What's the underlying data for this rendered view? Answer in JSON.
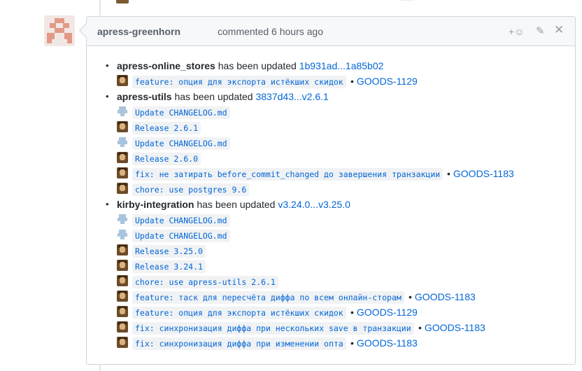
{
  "comment": {
    "author": "apress-greenhorn",
    "action": "commented",
    "time": "6 hours ago"
  },
  "header_icons": [
    "add-reaction-icon",
    "pencil-icon",
    "close-icon"
  ],
  "colors": {
    "link": "#0366d6",
    "header_bg": "#f6f8fa",
    "border": "#d1d5da",
    "avatar_accent": "#e39986"
  },
  "repos": [
    {
      "name": "apress-online_stores",
      "verb": "has been updated",
      "range": "1b931ad...1a85b02",
      "commits": [
        {
          "icon": "user",
          "message": "feature: опция для экспорта истёкших скидок",
          "ticket": "GOODS-1129"
        }
      ]
    },
    {
      "name": "apress-utils",
      "verb": "has been updated",
      "range": "3837d43...v2.6.1",
      "commits": [
        {
          "icon": "bot",
          "message": "Update CHANGELOG.md",
          "ticket": ""
        },
        {
          "icon": "user",
          "message": "Release 2.6.1",
          "ticket": ""
        },
        {
          "icon": "bot",
          "message": "Update CHANGELOG.md",
          "ticket": ""
        },
        {
          "icon": "user",
          "message": "Release 2.6.0",
          "ticket": ""
        },
        {
          "icon": "user",
          "message": "fix: не затирать before_commit_changed до завершения транзакции",
          "ticket": "GOODS-1183"
        },
        {
          "icon": "user",
          "message": "chore: use postgres 9.6",
          "ticket": ""
        }
      ]
    },
    {
      "name": "kirby-integration",
      "verb": "has been updated",
      "range": "v3.24.0...v3.25.0",
      "commits": [
        {
          "icon": "bot",
          "message": "Update CHANGELOG.md",
          "ticket": ""
        },
        {
          "icon": "bot",
          "message": "Update CHANGELOG.md",
          "ticket": ""
        },
        {
          "icon": "user",
          "message": "Release 3.25.0",
          "ticket": ""
        },
        {
          "icon": "user",
          "message": "Release 3.24.1",
          "ticket": ""
        },
        {
          "icon": "user",
          "message": "chore: use apress-utils 2.6.1",
          "ticket": ""
        },
        {
          "icon": "user",
          "message": "feature: таск для пересчёта диффа по всем онлайн-сторам",
          "ticket": "GOODS-1183"
        },
        {
          "icon": "user",
          "message": "feature: опция для экспорта истёкших скидок",
          "ticket": "GOODS-1129"
        },
        {
          "icon": "user",
          "message": "fix: синхронизация диффа при нескольких save в транзакции",
          "ticket": "GOODS-1183"
        },
        {
          "icon": "user",
          "message": "fix: синхронизация диффа при изменении опта",
          "ticket": "GOODS-1183"
        }
      ]
    }
  ]
}
